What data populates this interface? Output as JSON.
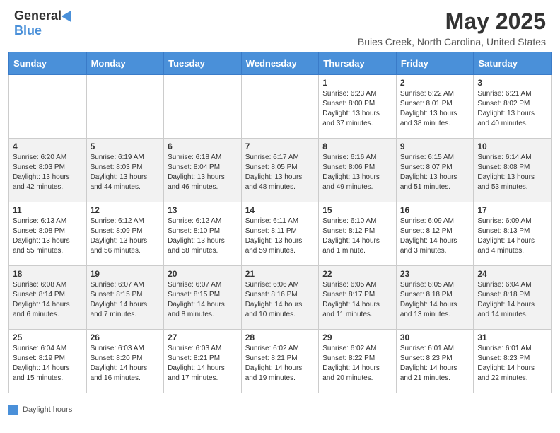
{
  "logo": {
    "general": "General",
    "blue": "Blue"
  },
  "title": "May 2025",
  "subtitle": "Buies Creek, North Carolina, United States",
  "days_of_week": [
    "Sunday",
    "Monday",
    "Tuesday",
    "Wednesday",
    "Thursday",
    "Friday",
    "Saturday"
  ],
  "footer": {
    "legend_label": "Daylight hours"
  },
  "weeks": [
    [
      {
        "day": "",
        "info": ""
      },
      {
        "day": "",
        "info": ""
      },
      {
        "day": "",
        "info": ""
      },
      {
        "day": "",
        "info": ""
      },
      {
        "day": "1",
        "info": "Sunrise: 6:23 AM\nSunset: 8:00 PM\nDaylight: 13 hours and 37 minutes."
      },
      {
        "day": "2",
        "info": "Sunrise: 6:22 AM\nSunset: 8:01 PM\nDaylight: 13 hours and 38 minutes."
      },
      {
        "day": "3",
        "info": "Sunrise: 6:21 AM\nSunset: 8:02 PM\nDaylight: 13 hours and 40 minutes."
      }
    ],
    [
      {
        "day": "4",
        "info": "Sunrise: 6:20 AM\nSunset: 8:03 PM\nDaylight: 13 hours and 42 minutes."
      },
      {
        "day": "5",
        "info": "Sunrise: 6:19 AM\nSunset: 8:03 PM\nDaylight: 13 hours and 44 minutes."
      },
      {
        "day": "6",
        "info": "Sunrise: 6:18 AM\nSunset: 8:04 PM\nDaylight: 13 hours and 46 minutes."
      },
      {
        "day": "7",
        "info": "Sunrise: 6:17 AM\nSunset: 8:05 PM\nDaylight: 13 hours and 48 minutes."
      },
      {
        "day": "8",
        "info": "Sunrise: 6:16 AM\nSunset: 8:06 PM\nDaylight: 13 hours and 49 minutes."
      },
      {
        "day": "9",
        "info": "Sunrise: 6:15 AM\nSunset: 8:07 PM\nDaylight: 13 hours and 51 minutes."
      },
      {
        "day": "10",
        "info": "Sunrise: 6:14 AM\nSunset: 8:08 PM\nDaylight: 13 hours and 53 minutes."
      }
    ],
    [
      {
        "day": "11",
        "info": "Sunrise: 6:13 AM\nSunset: 8:08 PM\nDaylight: 13 hours and 55 minutes."
      },
      {
        "day": "12",
        "info": "Sunrise: 6:12 AM\nSunset: 8:09 PM\nDaylight: 13 hours and 56 minutes."
      },
      {
        "day": "13",
        "info": "Sunrise: 6:12 AM\nSunset: 8:10 PM\nDaylight: 13 hours and 58 minutes."
      },
      {
        "day": "14",
        "info": "Sunrise: 6:11 AM\nSunset: 8:11 PM\nDaylight: 13 hours and 59 minutes."
      },
      {
        "day": "15",
        "info": "Sunrise: 6:10 AM\nSunset: 8:12 PM\nDaylight: 14 hours and 1 minute."
      },
      {
        "day": "16",
        "info": "Sunrise: 6:09 AM\nSunset: 8:12 PM\nDaylight: 14 hours and 3 minutes."
      },
      {
        "day": "17",
        "info": "Sunrise: 6:09 AM\nSunset: 8:13 PM\nDaylight: 14 hours and 4 minutes."
      }
    ],
    [
      {
        "day": "18",
        "info": "Sunrise: 6:08 AM\nSunset: 8:14 PM\nDaylight: 14 hours and 6 minutes."
      },
      {
        "day": "19",
        "info": "Sunrise: 6:07 AM\nSunset: 8:15 PM\nDaylight: 14 hours and 7 minutes."
      },
      {
        "day": "20",
        "info": "Sunrise: 6:07 AM\nSunset: 8:15 PM\nDaylight: 14 hours and 8 minutes."
      },
      {
        "day": "21",
        "info": "Sunrise: 6:06 AM\nSunset: 8:16 PM\nDaylight: 14 hours and 10 minutes."
      },
      {
        "day": "22",
        "info": "Sunrise: 6:05 AM\nSunset: 8:17 PM\nDaylight: 14 hours and 11 minutes."
      },
      {
        "day": "23",
        "info": "Sunrise: 6:05 AM\nSunset: 8:18 PM\nDaylight: 14 hours and 13 minutes."
      },
      {
        "day": "24",
        "info": "Sunrise: 6:04 AM\nSunset: 8:18 PM\nDaylight: 14 hours and 14 minutes."
      }
    ],
    [
      {
        "day": "25",
        "info": "Sunrise: 6:04 AM\nSunset: 8:19 PM\nDaylight: 14 hours and 15 minutes."
      },
      {
        "day": "26",
        "info": "Sunrise: 6:03 AM\nSunset: 8:20 PM\nDaylight: 14 hours and 16 minutes."
      },
      {
        "day": "27",
        "info": "Sunrise: 6:03 AM\nSunset: 8:21 PM\nDaylight: 14 hours and 17 minutes."
      },
      {
        "day": "28",
        "info": "Sunrise: 6:02 AM\nSunset: 8:21 PM\nDaylight: 14 hours and 19 minutes."
      },
      {
        "day": "29",
        "info": "Sunrise: 6:02 AM\nSunset: 8:22 PM\nDaylight: 14 hours and 20 minutes."
      },
      {
        "day": "30",
        "info": "Sunrise: 6:01 AM\nSunset: 8:23 PM\nDaylight: 14 hours and 21 minutes."
      },
      {
        "day": "31",
        "info": "Sunrise: 6:01 AM\nSunset: 8:23 PM\nDaylight: 14 hours and 22 minutes."
      }
    ]
  ]
}
